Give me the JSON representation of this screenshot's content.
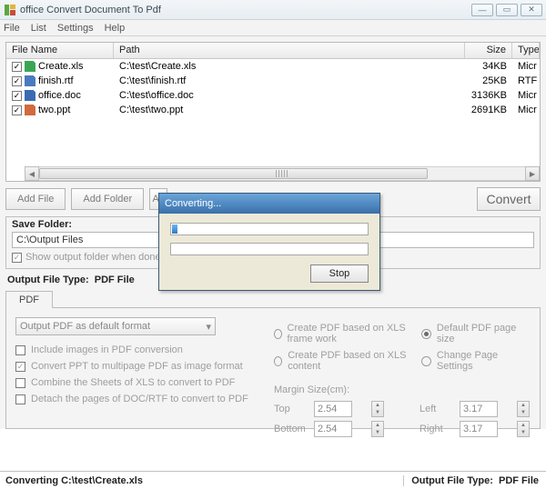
{
  "window": {
    "title": "office Convert Document To Pdf"
  },
  "menu": [
    "File",
    "List",
    "Settings",
    "Help"
  ],
  "columns": {
    "name": "File Name",
    "path": "Path",
    "size": "Size",
    "type": "Type"
  },
  "files": [
    {
      "checked": true,
      "icon": "xls",
      "name": "Create.xls",
      "path": "C:\\test\\Create.xls",
      "size": "34KB",
      "type": "Micr"
    },
    {
      "checked": true,
      "icon": "rtf",
      "name": "finish.rtf",
      "path": "C:\\test\\finish.rtf",
      "size": "25KB",
      "type": "RTF"
    },
    {
      "checked": true,
      "icon": "doc",
      "name": "office.doc",
      "path": "C:\\test\\office.doc",
      "size": "3136KB",
      "type": "Micr"
    },
    {
      "checked": true,
      "icon": "ppt",
      "name": "two.ppt",
      "path": "C:\\test\\two.ppt",
      "size": "2691KB",
      "type": "Micr"
    }
  ],
  "buttons": {
    "add_file": "Add File",
    "add_folder": "Add Folder",
    "add_partial": "Ad",
    "convert": "Convert"
  },
  "save_folder": {
    "legend": "Save Folder:",
    "value": "C:\\Output Files",
    "show_done": "Show output folder when done"
  },
  "output_type": {
    "label": "Output File Type:",
    "value": "PDF File"
  },
  "tab": {
    "label": "PDF"
  },
  "pdf": {
    "format_select": "Output PDF as default format",
    "opt1": "Include images in PDF conversion",
    "opt2": "Convert PPT to multipage PDF as image format",
    "opt3": "Combine the Sheets of XLS to convert to PDF",
    "opt4": "Detach the pages of DOC/RTF to convert to PDF",
    "r1": "Create PDF based on XLS frame work",
    "r2": "Create PDF based on XLS content",
    "r3": "Default PDF page size",
    "r4": "Change Page Settings",
    "margin_label": "Margin Size(cm):",
    "top": "Top",
    "bottom": "Bottom",
    "left": "Left",
    "right": "Right",
    "v_top": "2.54",
    "v_bottom": "2.54",
    "v_left": "3.17",
    "v_right": "3.17"
  },
  "status": {
    "left": "Converting  C:\\test\\Create.xls",
    "right_label": "Output File Type:",
    "right_value": "PDF File"
  },
  "dialog": {
    "title": "Converting...",
    "stop": "Stop"
  }
}
